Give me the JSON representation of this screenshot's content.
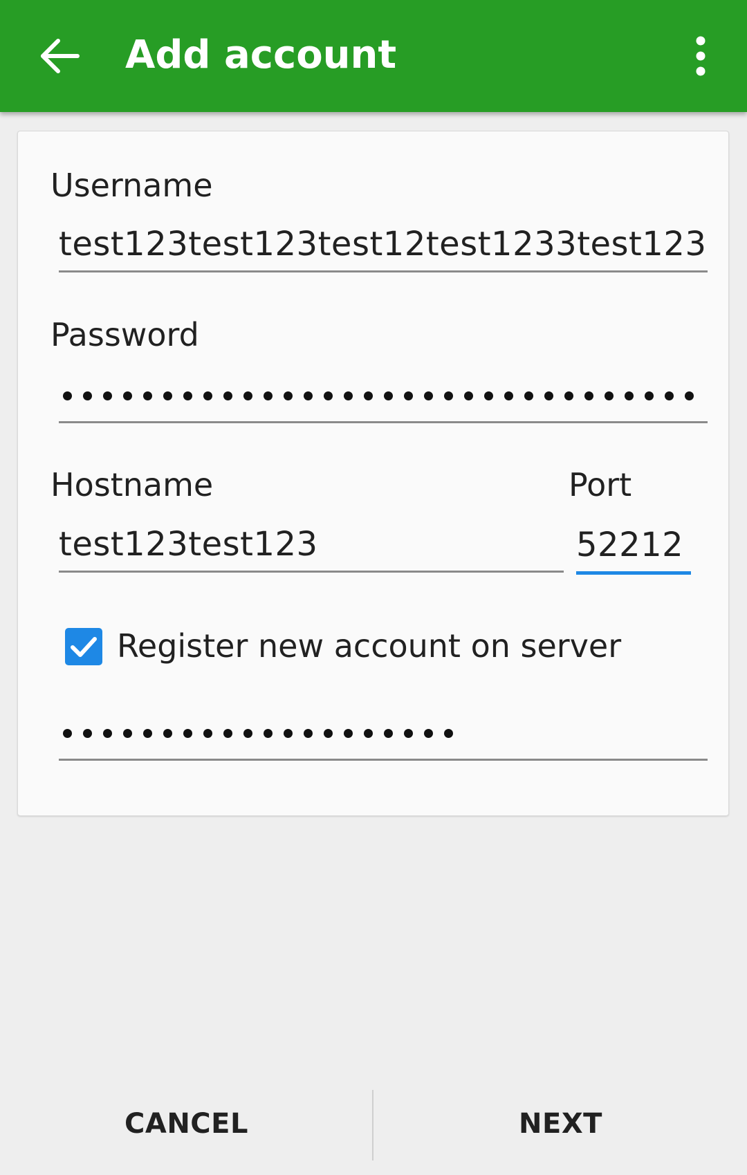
{
  "appbar": {
    "title": "Add account",
    "back_icon": "arrow-left-icon",
    "menu_icon": "more-vert-icon",
    "color": "#279d25"
  },
  "form": {
    "username_label": "Username",
    "username_value": "test123test123test12test1233test123",
    "password_label": "Password",
    "password_dot_count": 32,
    "hostname_label": "Hostname",
    "hostname_value": "test123test123",
    "port_label": "Port",
    "port_value": "52212",
    "register_label": "Register new account on server",
    "register_checked": true,
    "confirm_password_dot_count": 20,
    "accent_color": "#1e88e5"
  },
  "buttons": {
    "cancel": "CANCEL",
    "next": "NEXT"
  }
}
